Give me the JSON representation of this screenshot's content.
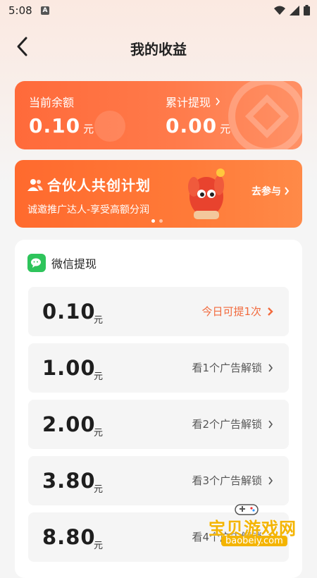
{
  "status_bar": {
    "time": "5:08",
    "notification_badge": "A"
  },
  "nav": {
    "title": "我的收益"
  },
  "balance": {
    "current_label": "当前余额",
    "current_value": "0.10",
    "current_unit": "元",
    "total_label": "累计提现",
    "total_value": "0.00",
    "total_unit": "元"
  },
  "banner": {
    "title": "合伙人共创计划",
    "subtitle": "诚邀推广达人-享受高额分润",
    "button": "去参与"
  },
  "withdraw": {
    "header": "微信提现",
    "options": [
      {
        "amount": "0.10",
        "unit": "元",
        "status": "今日可提1次"
      },
      {
        "amount": "1.00",
        "unit": "元",
        "status": "看1个广告解锁"
      },
      {
        "amount": "2.00",
        "unit": "元",
        "status": "看2个广告解锁"
      },
      {
        "amount": "3.80",
        "unit": "元",
        "status": "看3个广告解锁"
      },
      {
        "amount": "8.80",
        "unit": "元",
        "status": "看4个广告解锁"
      }
    ]
  },
  "watermark": {
    "text": "宝贝游戏网",
    "url": "baobeiy.com"
  },
  "colors": {
    "accent": "#ff6a3a",
    "highlight": "#f26a3d",
    "wechat": "#2ec45b"
  }
}
